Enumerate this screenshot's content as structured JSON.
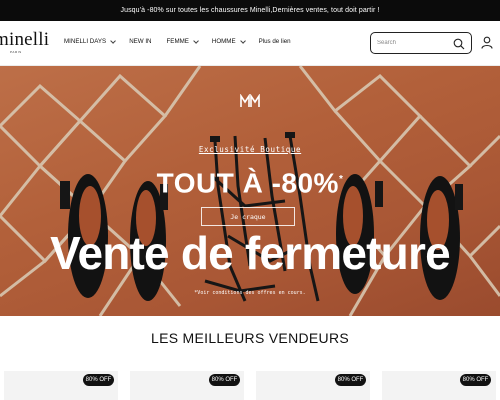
{
  "announcement": "Jusqu'à -80% sur toutes les chaussures Minelli,Dernières ventes, tout doit partir !",
  "header": {
    "logo": "minelli",
    "logo_sub": "PARIS",
    "nav": [
      {
        "label": "MINELLI DAYS",
        "has_chevron": true
      },
      {
        "label": "NEW IN",
        "has_chevron": false
      },
      {
        "label": "FEMME",
        "has_chevron": true
      },
      {
        "label": "HOMME",
        "has_chevron": true
      },
      {
        "label": "Plus de lien",
        "has_chevron": false
      }
    ],
    "search_placeholder": "Search",
    "icons": {
      "search": "search-icon",
      "account": "account-icon"
    }
  },
  "hero": {
    "brand_mark": "MM",
    "kicker": "Exclusivité Boutique",
    "headline": "TOUT À -80%",
    "asterisk": "*",
    "cta": "Je craque",
    "big_text": "Vente de fermeture",
    "note": "*Voir conditions des offres en cours."
  },
  "bestsellers": {
    "title": "LES MEILLEURS VENDEURS",
    "cards": [
      {
        "badge": "80% OFF"
      },
      {
        "badge": "80% OFF"
      },
      {
        "badge": "80% OFF"
      },
      {
        "badge": "80% OFF"
      }
    ]
  },
  "colors": {
    "announcement_bg": "#0b0b0b",
    "tile": "#b2603a",
    "grout": "#d9c9b4",
    "shoe": "#121212"
  }
}
